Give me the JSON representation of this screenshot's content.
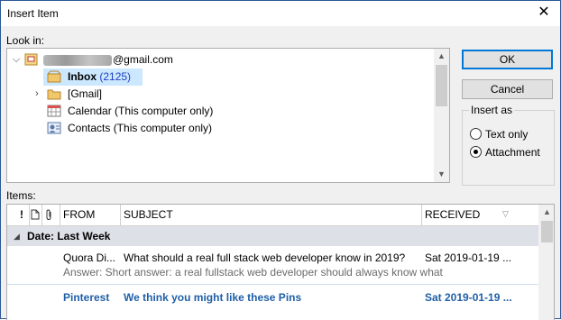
{
  "window": {
    "title": "Insert Item",
    "close_glyph": "✕"
  },
  "look_in": {
    "label": "Look in:",
    "account_suffix": "@gmail.com",
    "folders": [
      {
        "name": "Inbox",
        "count": "(2125)"
      },
      {
        "name": "[Gmail]"
      },
      {
        "name": "Calendar (This computer only)"
      },
      {
        "name": "Contacts (This computer only)"
      }
    ]
  },
  "buttons": {
    "ok": "OK",
    "cancel": "Cancel"
  },
  "insert_as": {
    "title": "Insert as",
    "options": [
      {
        "label": "Text only",
        "selected": false
      },
      {
        "label": "Attachment",
        "selected": true
      }
    ]
  },
  "items": {
    "label": "Items:",
    "columns": {
      "importance": "!",
      "icon": "",
      "attachment": "",
      "from": "FROM",
      "subject": "SUBJECT",
      "received": "RECEIVED"
    },
    "group_label": "Date: Last Week",
    "messages": [
      {
        "from": "Quora Di...",
        "subject": "What should a real full stack web developer know in 2019?",
        "received": "Sat 2019-01-19 ...",
        "preview": "Answer: Short answer: a real fullstack web developer should always know what",
        "unread": false
      },
      {
        "from": "Pinterest",
        "subject": "We think you might like these Pins",
        "received": "Sat 2019-01-19 ...",
        "unread": true
      }
    ]
  },
  "colors": {
    "selection": "#cce8ff",
    "unread": "#1f5fa8",
    "group_band": "#dde1e7",
    "border_blue": "#2b5797"
  }
}
